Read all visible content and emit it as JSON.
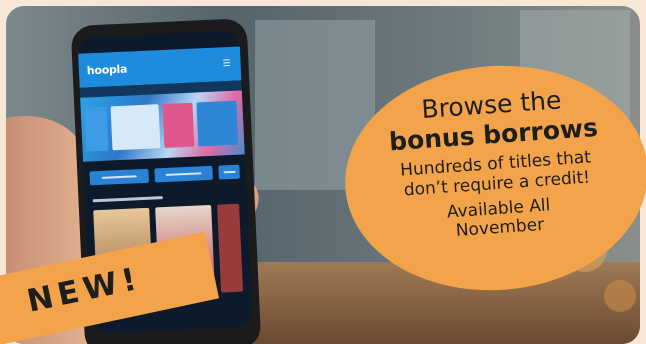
{
  "colors": {
    "background": "#f8e6d6",
    "accent": "#f3a44a",
    "text": "#1e1e1e",
    "app_blue": "#1e8bdc",
    "app_dark": "#0c1a2c"
  },
  "icons": {
    "menu": "menu-icon"
  },
  "phone": {
    "app_name": "hoopla"
  },
  "callout": {
    "headline_line1": "Browse the",
    "headline_line2": "bonus borrows",
    "subtext_line1": "Hundreds of titles that",
    "subtext_line2": "don’t require a credit!",
    "availability_line1": "Available All",
    "availability_line2": "November"
  },
  "badge": {
    "label": "NEW!"
  }
}
